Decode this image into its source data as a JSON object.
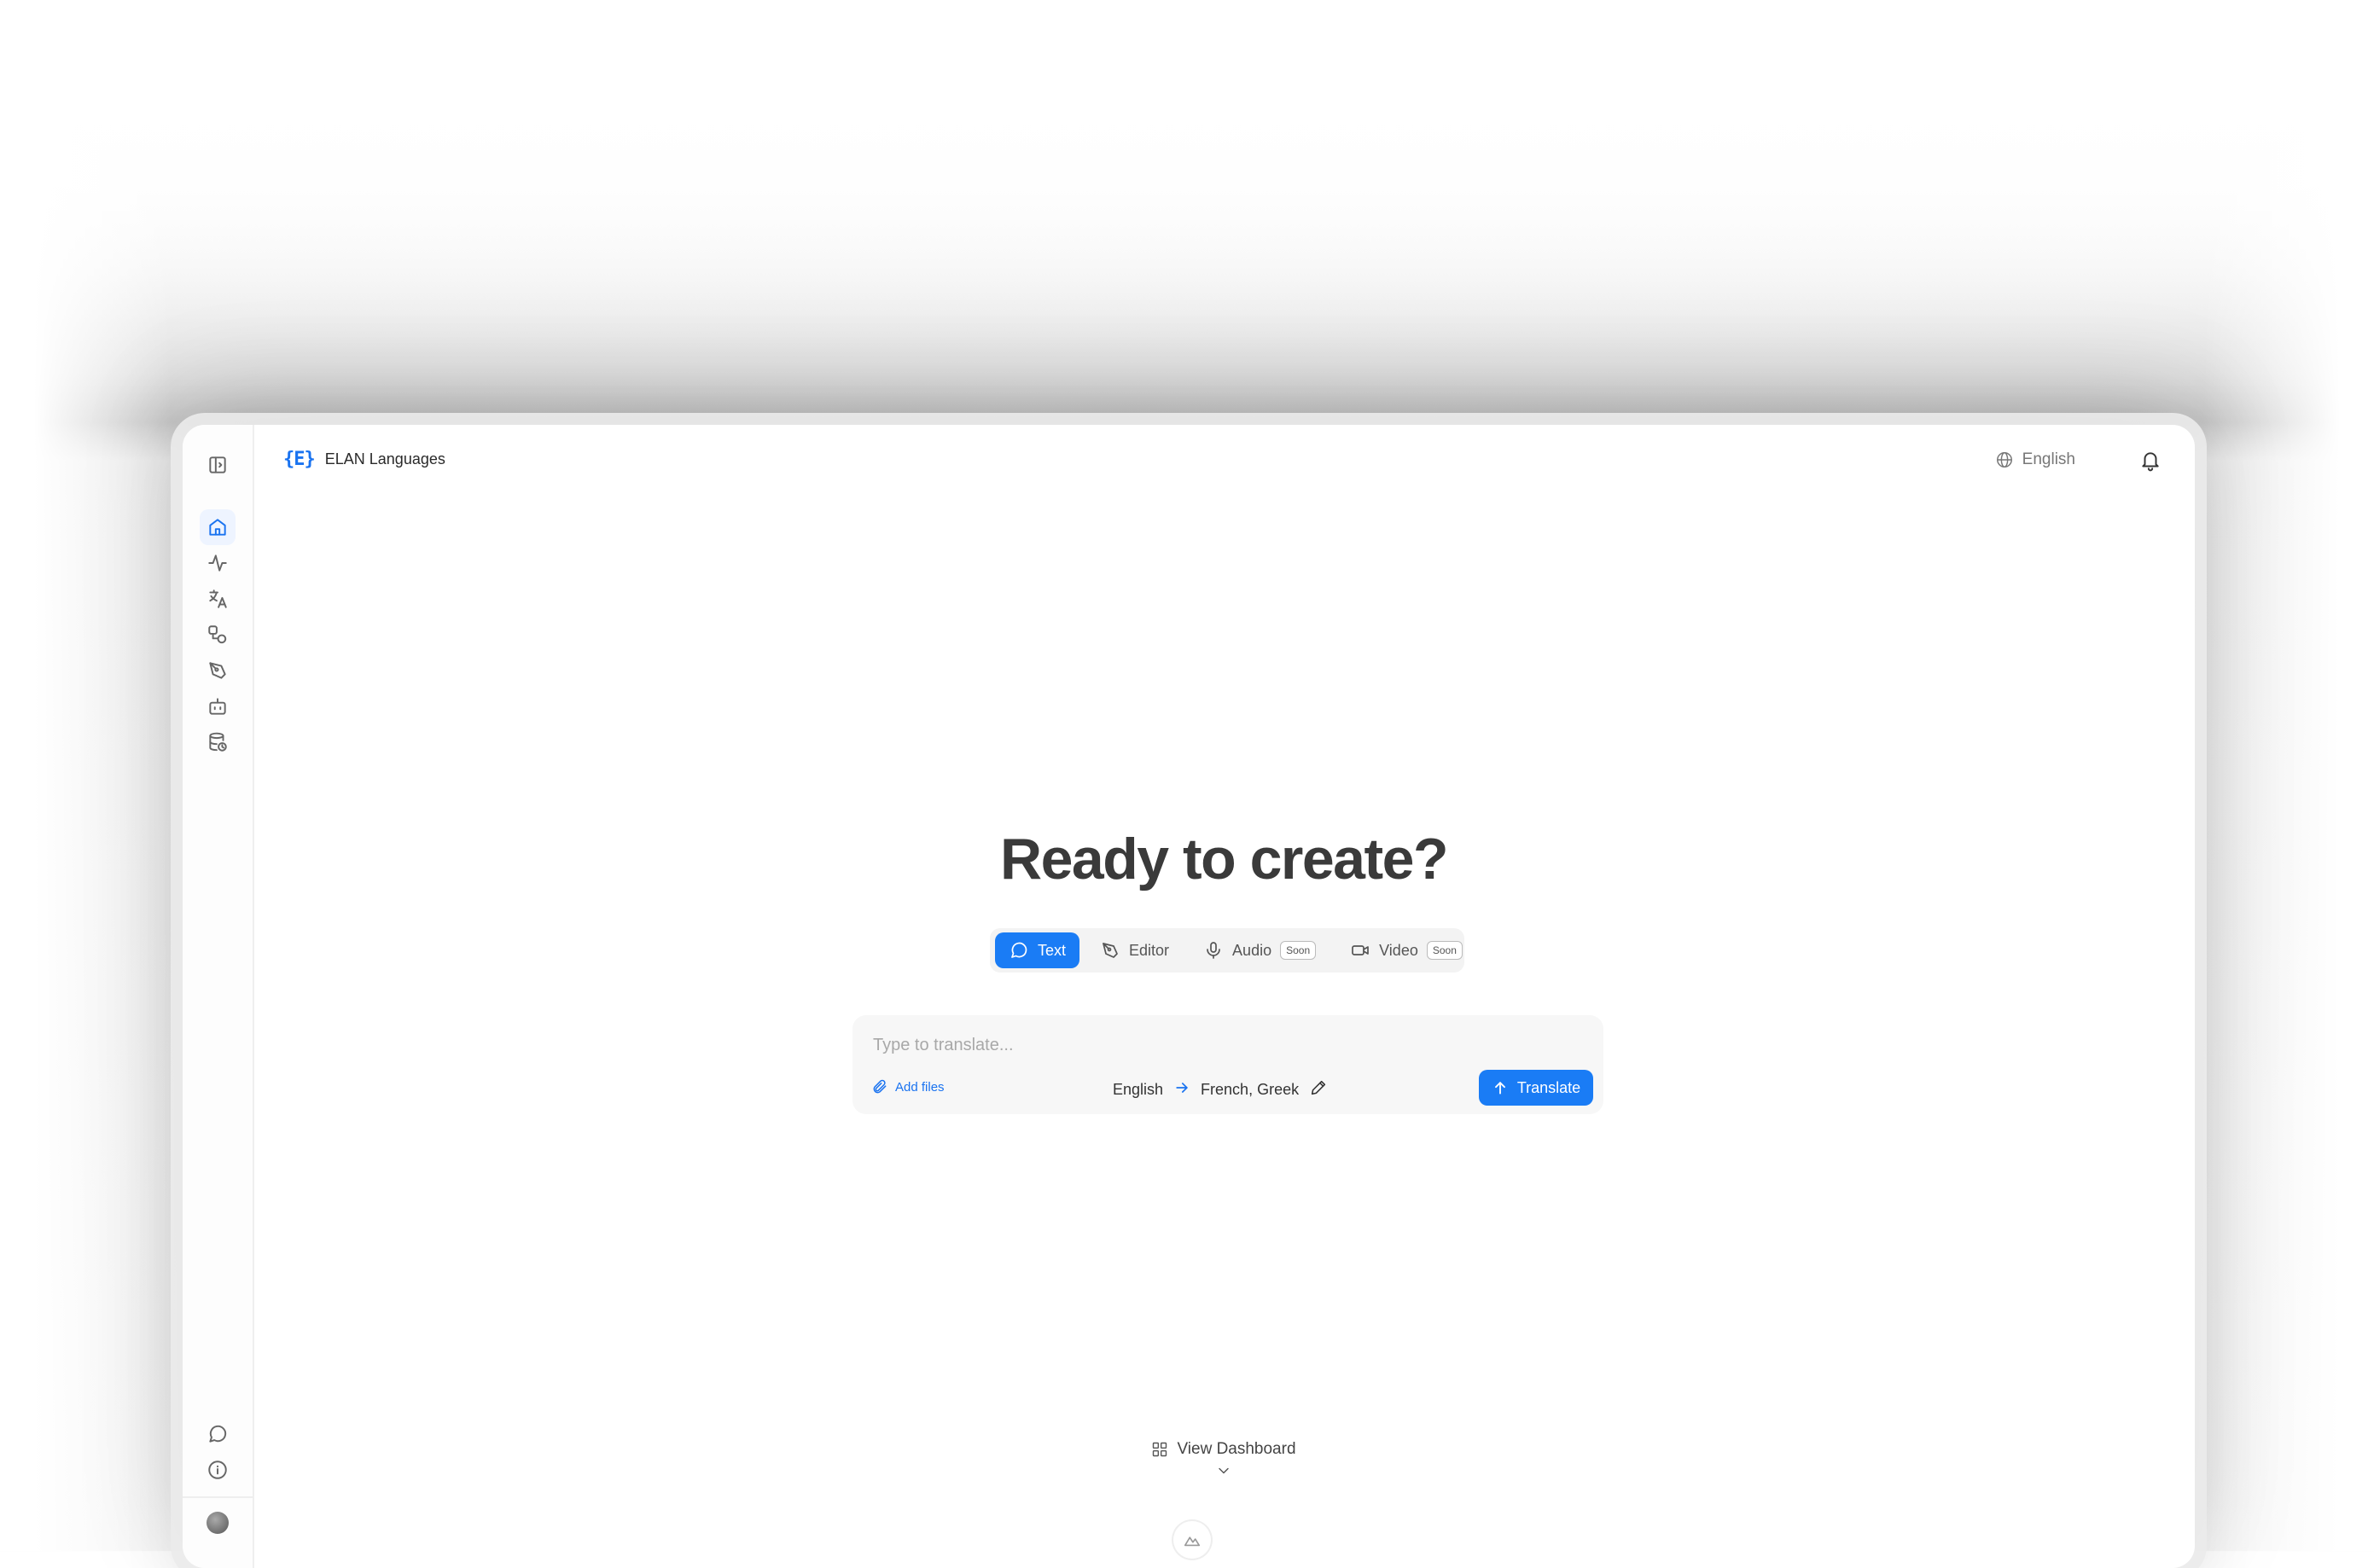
{
  "app": {
    "brand_logo": "{E}",
    "brand_name": "ELAN Languages",
    "ui_language": "English"
  },
  "sidebar": {
    "items": [
      {
        "name": "home",
        "icon": "home-icon",
        "active": true
      },
      {
        "name": "activity",
        "icon": "activity-icon",
        "active": false
      },
      {
        "name": "translate",
        "icon": "translate-icon",
        "active": false
      },
      {
        "name": "workflows",
        "icon": "shapes-icon",
        "active": false
      },
      {
        "name": "editor",
        "icon": "pen-tool-icon",
        "active": false
      },
      {
        "name": "bot",
        "icon": "bot-icon",
        "active": false
      },
      {
        "name": "database",
        "icon": "database-history-icon",
        "active": false
      }
    ],
    "bottom_items": [
      {
        "name": "chat",
        "icon": "message-circle-icon"
      },
      {
        "name": "info",
        "icon": "info-icon"
      }
    ]
  },
  "main": {
    "headline": "Ready to create?",
    "modes": [
      {
        "label": "Text",
        "icon": "message-circle-icon",
        "active": true,
        "badge": ""
      },
      {
        "label": "Editor",
        "icon": "pen-tool-icon",
        "active": false,
        "badge": ""
      },
      {
        "label": "Audio",
        "icon": "mic-icon",
        "active": false,
        "badge": "Soon"
      },
      {
        "label": "Video",
        "icon": "video-icon",
        "active": false,
        "badge": "Soon"
      }
    ],
    "composer": {
      "placeholder": "Type to translate...",
      "value": "",
      "add_files_label": "Add files",
      "source_language": "English",
      "target_languages": "French, Greek",
      "translate_label": "Translate"
    },
    "view_dashboard_label": "View Dashboard"
  },
  "colors": {
    "accent": "#1a7cf5",
    "text_primary": "#3a3a3a",
    "muted": "#777777"
  }
}
